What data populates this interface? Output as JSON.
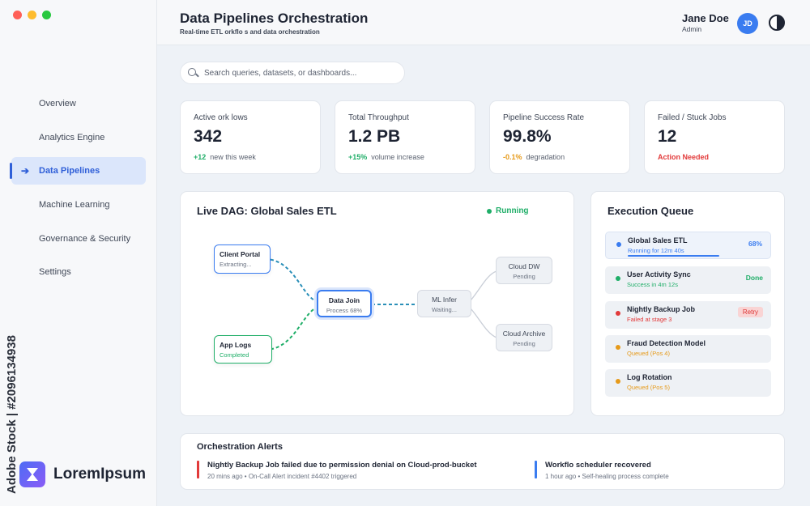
{
  "window": {
    "controls": [
      {
        "name": "close",
        "color": "#ff5f57"
      },
      {
        "name": "minimize",
        "color": "#febc2e"
      },
      {
        "name": "maximize",
        "color": "#28c840"
      }
    ]
  },
  "sidebar": {
    "items": [
      {
        "label": "Overview",
        "active": false
      },
      {
        "label": "Analytics Engine",
        "active": false
      },
      {
        "label": "Data Pipelines",
        "active": true
      },
      {
        "label": "Machine Learning",
        "active": false
      },
      {
        "label": "Governance & Security",
        "active": false
      },
      {
        "label": "Settings",
        "active": false
      }
    ],
    "logo_text": "LoremIpsum"
  },
  "watermark": {
    "text": "Adobe Stock | #2096134938"
  },
  "header": {
    "title": "Data Pipelines Orchestration",
    "subtitle": "Real-time ETL   orkflo   s and data orchestration",
    "user_name": "Jane Doe",
    "user_role": "Admin",
    "avatar_initials": "JD"
  },
  "search": {
    "placeholder": "Search queries, datasets, or dashboards..."
  },
  "stats": [
    {
      "label": "Active    ork  lows",
      "value": "342",
      "delta": "+12",
      "delta_text": "new this week"
    },
    {
      "label": "Total Throughput",
      "value": "1.2 PB",
      "delta": "+15%",
      "delta_text": "volume increase"
    },
    {
      "label": "Pipeline Success Rate",
      "value": "99.8%",
      "delta": "-0.1%",
      "delta_text": "degradation"
    },
    {
      "label": "Failed / Stuck Jobs",
      "value": "12",
      "delta": "",
      "delta_text": "Action Needed"
    }
  ],
  "dag": {
    "title": "Live DAG: Global Sales ETL",
    "status": "Running",
    "nodes": {
      "client_portal": {
        "title": "Client Portal",
        "sub": "Extracting..."
      },
      "app_logs": {
        "title": "App Logs",
        "sub": "Completed"
      },
      "data_join": {
        "title": "Data Join",
        "sub": "Process 68%"
      },
      "ml_infer": {
        "title": "ML Infer",
        "sub": "Waiting..."
      },
      "cloud_dw": {
        "title": "Cloud DW",
        "sub": "Pending"
      },
      "cloud_archive": {
        "title": "Cloud Archive",
        "sub": "Pending"
      }
    }
  },
  "queue": {
    "title": "Execution Queue",
    "items": [
      {
        "name": "Global Sales ETL",
        "sub": "Running for 12m 40s",
        "right": "68%",
        "status": "running",
        "progress": 0.68
      },
      {
        "name": "User Activity Sync",
        "sub": "Success in 4m 12s",
        "right": "Done",
        "status": "done"
      },
      {
        "name": "Nightly Backup Job",
        "sub": "Failed at stage 3",
        "right": "Retry",
        "status": "failed"
      },
      {
        "name": "Fraud Detection Model",
        "sub": "Queued (Pos 4)",
        "right": "",
        "status": "queued"
      },
      {
        "name": "Log Rotation",
        "sub": "Queued (Pos 5)",
        "right": "",
        "status": "queued"
      }
    ]
  },
  "alerts": {
    "title": "Orchestration Alerts",
    "items": [
      {
        "title": "Nightly Backup Job failed due to permission denial on Cloud-prod-bucket",
        "sub": "20 mins ago • On-Call Alert incident #4402 triggered",
        "color": "#e23a3a"
      },
      {
        "title": "Workflo    scheduler recovered",
        "sub": "1 hour ago • Self-healing process complete",
        "color": "#3a7cf0"
      }
    ]
  },
  "colors": {
    "accent": "#3a7cf0",
    "success": "#1fae68",
    "warning": "#e69a1a",
    "danger": "#e23a3a"
  }
}
